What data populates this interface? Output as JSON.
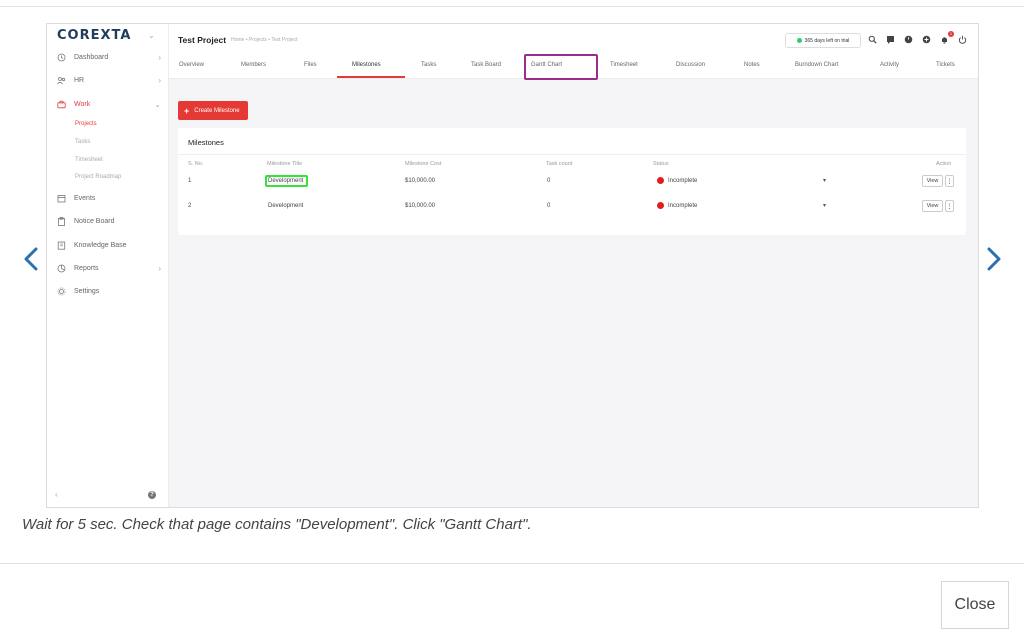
{
  "screenshot": {
    "logo": "COREXTA",
    "sidebar": {
      "items": [
        {
          "label": "Dashboard",
          "icon": "clock-icon"
        },
        {
          "label": "HR",
          "icon": "people-icon"
        },
        {
          "label": "Work",
          "icon": "briefcase-icon"
        },
        {
          "label": "Events",
          "icon": "calendar-icon"
        },
        {
          "label": "Notice Board",
          "icon": "clipboard-icon"
        },
        {
          "label": "Knowledge Base",
          "icon": "book-icon"
        },
        {
          "label": "Reports",
          "icon": "chart-icon"
        },
        {
          "label": "Settings",
          "icon": "gear-icon"
        }
      ],
      "sub_items": [
        "Projects",
        "Tasks",
        "Timesheet",
        "Project Roadmap"
      ],
      "collapse_label": "‹",
      "help_label": "?"
    },
    "header": {
      "project_title": "Test Project",
      "breadcrumb": "Home • Projects • Test Project",
      "trial_text": "365 days left on trial",
      "notification_count": "1"
    },
    "tabs": [
      "Overview",
      "Members",
      "Files",
      "Milestones",
      "Tasks",
      "Task Board",
      "Gantt Chart",
      "Timesheet",
      "Discussion",
      "Notes",
      "Burndown Chart",
      "Activity",
      "Tickets"
    ],
    "create_button": "Create Milestone",
    "milestones": {
      "title": "Milestones",
      "columns": [
        "S. No.",
        "Milestone Title",
        "Milestone Cost",
        "Task count",
        "Status",
        "Action"
      ],
      "rows": [
        {
          "sno": "1",
          "title": "Development",
          "cost": "$10,000.00",
          "tasks": "0",
          "status": "Incomplete",
          "action": "View"
        },
        {
          "sno": "2",
          "title": "Development",
          "cost": "$10,000.00",
          "tasks": "0",
          "status": "Incomplete",
          "action": "View"
        }
      ]
    }
  },
  "caption": "Wait for 5 sec. Check that page contains \"Development\". Click \"Gantt Chart\".",
  "close_label": "Close",
  "colors": {
    "accent": "#e53935",
    "highlight_tab": "#9b2d8a",
    "highlight_text": "#38e038",
    "status_dot": "#e01e1e",
    "trial_dot": "#2ecc71"
  }
}
